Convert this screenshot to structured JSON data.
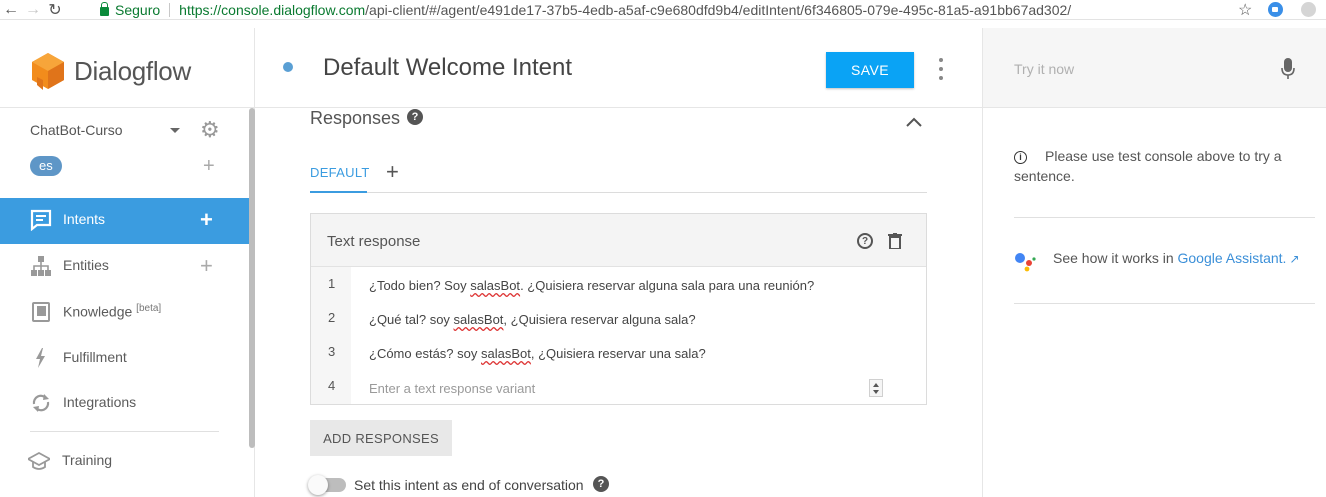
{
  "browser": {
    "secure_label": "Seguro",
    "url_host": "https://console.dialogflow.com",
    "url_path": "/api-client/#/agent/e491de17-37b5-4edb-a5af-c9e680dfd9b4/editIntent/6f346805-079e-495c-81a5-a91bb67ad302/"
  },
  "sidebar": {
    "brand": "Dialogflow",
    "agent_name": "ChatBot-Curso",
    "language": "es",
    "items": [
      {
        "label": "Intents",
        "active": true,
        "icon": "chat-bubble-icon"
      },
      {
        "label": "Entities",
        "icon": "hierarchy-icon"
      },
      {
        "label": "Knowledge",
        "badge": "[beta]",
        "icon": "book-icon"
      },
      {
        "label": "Fulfillment",
        "icon": "bolt-icon"
      },
      {
        "label": "Integrations",
        "icon": "sync-icon"
      },
      {
        "label": "Training",
        "icon": "graduation-cap-icon"
      }
    ]
  },
  "header": {
    "intent_title": "Default Welcome Intent",
    "save_label": "SAVE"
  },
  "responses": {
    "section_title": "Responses",
    "tab_default": "DEFAULT",
    "card_title": "Text response",
    "rows": [
      {
        "num": "1",
        "before": "¿Todo bien? Soy ",
        "misspelled": "salasBot",
        "after": ". ¿Quisiera reservar alguna sala para una reunión?"
      },
      {
        "num": "2",
        "before": "¿Qué tal? soy ",
        "misspelled": "salasBot",
        "after": ", ¿Quisiera reservar alguna sala?"
      },
      {
        "num": "3",
        "before": "¿Cómo estás? soy ",
        "misspelled": "salasBot",
        "after": ", ¿Quisiera reservar una sala?"
      }
    ],
    "new_row_num": "4",
    "new_row_placeholder": "Enter a text response variant",
    "add_button": "ADD RESPONSES",
    "end_conversation_label": "Set this intent as end of conversation"
  },
  "right_panel": {
    "try_placeholder": "Try it now",
    "info_text": "Please use test console above to try a sentence.",
    "assistant_prefix": "See how it works in ",
    "assistant_link": "Google Assistant."
  },
  "colors": {
    "accent": "#3b9ce0",
    "save_button": "#0aa3f5",
    "logo_orange": "#f28c1c"
  }
}
